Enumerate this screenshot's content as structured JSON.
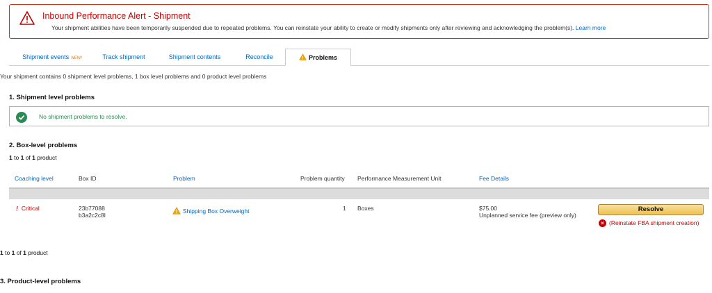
{
  "alert": {
    "title": "Inbound Performance Alert - Shipment",
    "message": "Your shipment abilities have been temporarily suspended due to repeated problems. You can reinstate your ability to create or modify shipments only after reviewing and acknowledging the problem(s).",
    "link": "Learn more"
  },
  "tabs": [
    {
      "label": "Shipment events",
      "badge": "NEW!"
    },
    {
      "label": "Track shipment"
    },
    {
      "label": "Shipment contents"
    },
    {
      "label": "Reconcile"
    },
    {
      "label": "Problems",
      "active": true
    }
  ],
  "summary": "Your shipment contains 0 shipment level problems, 1 box level problems and 0 product level problems",
  "section1": {
    "title": "1. Shipment level problems",
    "ok_message": "No shipment problems to resolve."
  },
  "section2": {
    "title": "2. Box-level problems",
    "count": {
      "start": "1",
      "end": "1",
      "total": "1",
      "to": "to",
      "of": "of",
      "unit": "product"
    },
    "columns": {
      "coaching": "Coaching level",
      "box_id": "Box ID",
      "problem": "Problem",
      "quantity": "Problem quantity",
      "unit": "Performance Measurement Unit",
      "fee": "Fee Details"
    },
    "row": {
      "coaching": "Critical",
      "box_id_line1": "23b77088",
      "box_id_line2": "b3a2c2c8l",
      "problem": "Shipping Box Overweight",
      "quantity": "1",
      "unit": "Boxes",
      "fee_amount": "$75.00",
      "fee_desc": "Unplanned service fee (preview only)",
      "resolve_button": "Resolve",
      "reinstate": "(Reinstate FBA shipment creation)"
    }
  },
  "section3": {
    "title": "3. Product-level problems"
  },
  "colors": {
    "error": "#c40000",
    "success": "#2a8c52",
    "link": "#0066c0",
    "button": "#f0c14b"
  }
}
